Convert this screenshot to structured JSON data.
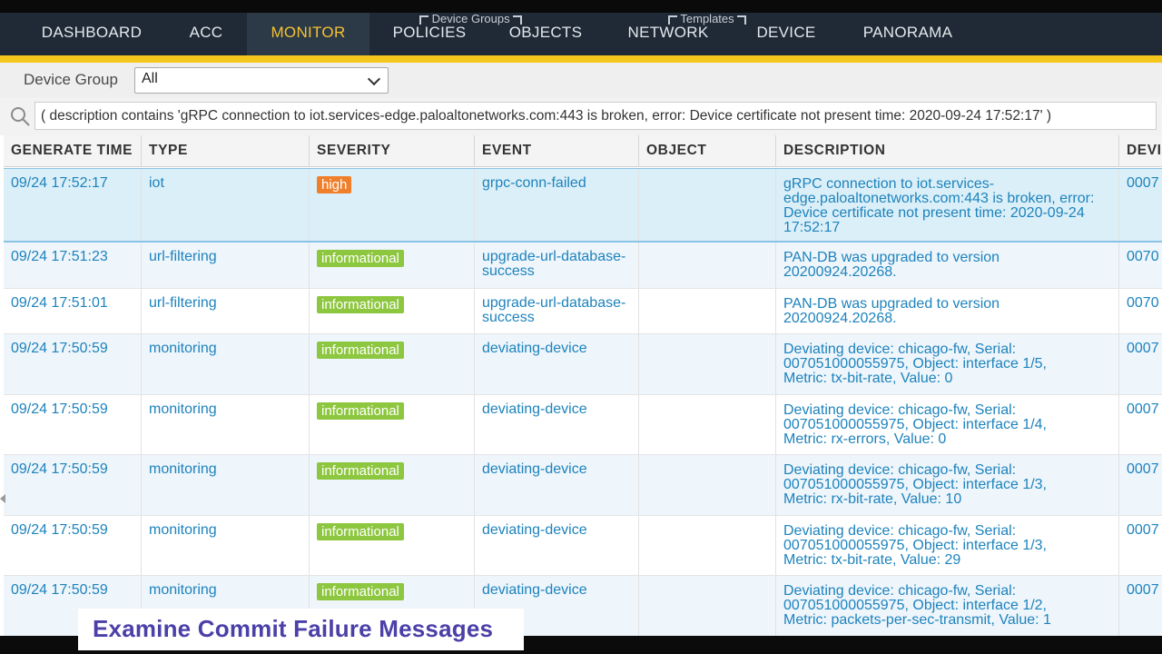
{
  "nav": {
    "groups": {
      "device_groups": "Device Groups",
      "templates": "Templates"
    },
    "items": [
      {
        "label": "DASHBOARD"
      },
      {
        "label": "ACC"
      },
      {
        "label": "MONITOR",
        "active": true
      },
      {
        "label": "POLICIES"
      },
      {
        "label": "OBJECTS"
      },
      {
        "label": "NETWORK"
      },
      {
        "label": "DEVICE"
      },
      {
        "label": "PANORAMA"
      }
    ],
    "accent_color": "#f5c231"
  },
  "device_group": {
    "label": "Device Group",
    "value": "All"
  },
  "filter": {
    "text": "( description contains 'gRPC connection to iot.services-edge.paloaltonetworks.com:443 is broken, error: Device certificate not present time: 2020-09-24 17:52:17' )",
    "icon": "search-icon"
  },
  "table": {
    "headers": [
      "GENERATE TIME",
      "TYPE",
      "SEVERITY",
      "EVENT",
      "OBJECT",
      "DESCRIPTION",
      "DEVI"
    ],
    "rows": [
      {
        "time": "09/24 17:52:17",
        "type": "iot",
        "severity": "high",
        "event": "grpc-conn-failed",
        "object": "",
        "description": [
          "gRPC connection to iot.services-",
          "edge.paloaltonetworks.com:443 is broken, error:",
          "Device certificate not present time: 2020-09-24",
          "17:52:17"
        ],
        "device": "0007"
      },
      {
        "time": "09/24 17:51:23",
        "type": "url-filtering",
        "severity": "informational",
        "event": [
          "upgrade-url-database-",
          "success"
        ],
        "object": "",
        "description": [
          "PAN-DB was upgraded to version",
          "20200924.20268."
        ],
        "device": "0070"
      },
      {
        "time": "09/24 17:51:01",
        "type": "url-filtering",
        "severity": "informational",
        "event": [
          "upgrade-url-database-",
          "success"
        ],
        "object": "",
        "description": [
          "PAN-DB was upgraded to version",
          "20200924.20268."
        ],
        "device": "0070"
      },
      {
        "time": "09/24 17:50:59",
        "type": "monitoring",
        "severity": "informational",
        "event": "deviating-device",
        "object": "",
        "description": [
          "Deviating device: chicago-fw, Serial:",
          "007051000055975, Object: interface 1/5,",
          "Metric: tx-bit-rate, Value: 0"
        ],
        "device": "0007"
      },
      {
        "time": "09/24 17:50:59",
        "type": "monitoring",
        "severity": "informational",
        "event": "deviating-device",
        "object": "",
        "description": [
          "Deviating device: chicago-fw, Serial:",
          "007051000055975, Object: interface 1/4,",
          "Metric: rx-errors, Value: 0"
        ],
        "device": "0007"
      },
      {
        "time": "09/24 17:50:59",
        "type": "monitoring",
        "severity": "informational",
        "event": "deviating-device",
        "object": "",
        "description": [
          "Deviating device: chicago-fw, Serial:",
          "007051000055975, Object: interface 1/3,",
          "Metric: rx-bit-rate, Value: 10"
        ],
        "device": "0007"
      },
      {
        "time": "09/24 17:50:59",
        "type": "monitoring",
        "severity": "informational",
        "event": "deviating-device",
        "object": "",
        "description": [
          "Deviating device: chicago-fw, Serial:",
          "007051000055975, Object: interface 1/3,",
          "Metric: tx-bit-rate, Value: 29"
        ],
        "device": "0007"
      },
      {
        "time": "09/24 17:50:59",
        "type": "monitoring",
        "severity": "informational",
        "event": "deviating-device",
        "object": "",
        "description": [
          "Deviating device: chicago-fw, Serial:",
          "007051000055975, Object: interface 1/2,",
          "Metric: packets-per-sec-transmit, Value: 1"
        ],
        "device": "0007"
      }
    ]
  },
  "caption": "Examine Commit Failure Messages",
  "colors": {
    "high": "#f07f2b",
    "informational": "#8dc63f",
    "link": "#1d83bd",
    "caption": "#4b3fa8"
  }
}
